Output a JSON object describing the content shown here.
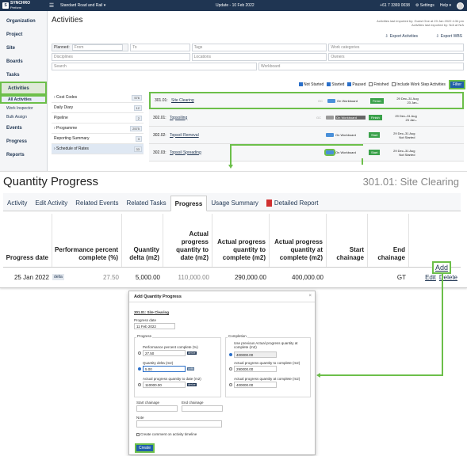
{
  "topbar": {
    "logo_line1": "SYNCHRO",
    "logo_line2": "Perform",
    "project": "Standard Road and Rail ▾",
    "update": "Update - 10 Feb 2022",
    "phone": "+61 7 3369 0038",
    "settings": "⚙ Settings",
    "help": "Help ▾"
  },
  "nav": {
    "items": [
      "Organization",
      "Project",
      "Site",
      "Boards",
      "Tasks",
      "Activities"
    ],
    "subitems": [
      "All Activities",
      "Work Inspector",
      "Bulk Assign"
    ],
    "items_after": [
      "Events",
      "Progress",
      "Reports"
    ]
  },
  "activities": {
    "title": "Activities",
    "import_note_1": "Activities last imported by: Guest One at 23 Jan 2022 4:34 pm",
    "import_note_2": "Activities last exported by: N/A at N/A",
    "export_activities": "Export Activities",
    "export_wbs": "Export WBS",
    "filters": {
      "planned_label": "Planned:",
      "from": "From",
      "to": "To",
      "tags": "Tags",
      "work_categories": "Work categories",
      "disciplines": "Disciplines",
      "locations": "Locations",
      "owners": "Owners",
      "search": "Search",
      "workboard": "Workboard"
    },
    "checks": [
      {
        "label": "Not Started",
        "checked": true
      },
      {
        "label": "Started",
        "checked": true
      },
      {
        "label": "Paused",
        "checked": true
      },
      {
        "label": "Finished",
        "checked": false
      },
      {
        "label": "Include Work Step Activities",
        "checked": false
      }
    ],
    "filter_button": "Filter",
    "categories": [
      {
        "label": "› Cost Codes",
        "count": "576"
      },
      {
        "label": "Daily Diary",
        "count": "12"
      },
      {
        "label": "Pipeline",
        "count": "2"
      },
      {
        "label": "› Programme",
        "count": "2575"
      },
      {
        "label": "Reporting Summary",
        "count": "3"
      },
      {
        "label": "› Schedule of Rates",
        "count": "33"
      }
    ],
    "rows": [
      {
        "id": "301.01:",
        "name": "Site Clearing",
        "gc": "GC",
        "workboard": "On Workboard",
        "btn": "Finish",
        "date1": "29 Dec–31 Aug",
        "date2": "23 Jan–"
      },
      {
        "id": "302.01:",
        "name": "Topsoiling",
        "gc": "GC",
        "workboard": "On Workboard",
        "btn": "Finish",
        "date1": "29 Dec–31 Aug",
        "date2": "23 Jan–"
      },
      {
        "id": "302.02:",
        "name": "Topsoil Removal",
        "gc": "",
        "workboard": "On Workboard",
        "btn": "Start",
        "date1": "29 Dec–31 Aug",
        "date2": "Not Started"
      },
      {
        "id": "302.03:",
        "name": "Topsoil Spreading",
        "gc": "",
        "workboard": "On Workboard",
        "btn": "Start",
        "date1": "29 Dec–31 Aug",
        "date2": "Not Started"
      }
    ]
  },
  "quantity": {
    "title": "Quantity Progress",
    "ref": "301.01: Site Clearing",
    "tabs": [
      "Activity",
      "Edit Activity",
      "Related Events",
      "Related Tasks",
      "Progress",
      "Usage Summary",
      "Detailed Report"
    ],
    "headers": [
      "Progress date",
      "Performance percent complete (%)",
      "Quantity delta (m2)",
      "Actual progress quantity to date (m2)",
      "Actual progress quantity to complete (m2)",
      "Actual progress quantity at complete (m2)",
      "Start chainage",
      "End chainage",
      ""
    ],
    "add": "Add",
    "row": {
      "date": "25 Jan 2022",
      "badge": "delta",
      "percent": "27.50",
      "delta": "5,000.00",
      "to_date": "110,000.00",
      "to_complete": "290,000.00",
      "at_complete": "400,000.00",
      "end_chainage": "GT",
      "edit": "Edit",
      "delete": "Delete"
    }
  },
  "dialog": {
    "title": "Add Quantity Progress",
    "activity": "301.01: Site Clearing",
    "progress_date_label": "Progress date",
    "progress_date": "11 Feb 2022",
    "progress_group": "Progress",
    "pct_label": "Performance percent complete (%)",
    "pct_value": "27.50",
    "delta_label": "Quantity delta (m2)",
    "delta_value": "5.00",
    "to_date_label": "Actual progress quantity to date (m2)",
    "to_date_value": "110000.00",
    "completion_group": "Completion",
    "use_prev_label": "Use previous Actual progress quantity at complete (m2)",
    "use_prev_value": "400000.00",
    "to_complete_label": "Actual progress quantity to complete (m2)",
    "to_complete_value": "290000.00",
    "at_complete_label": "Actual progress quantity at complete (m2)",
    "at_complete_value": "400000.00",
    "start_chainage": "Start chainage",
    "end_chainage": "End chainage",
    "note": "Note",
    "create_comment": "Create comment on activity timeline",
    "create_button": "Create",
    "badge_derive": "derive",
    "badge_units": "units"
  }
}
